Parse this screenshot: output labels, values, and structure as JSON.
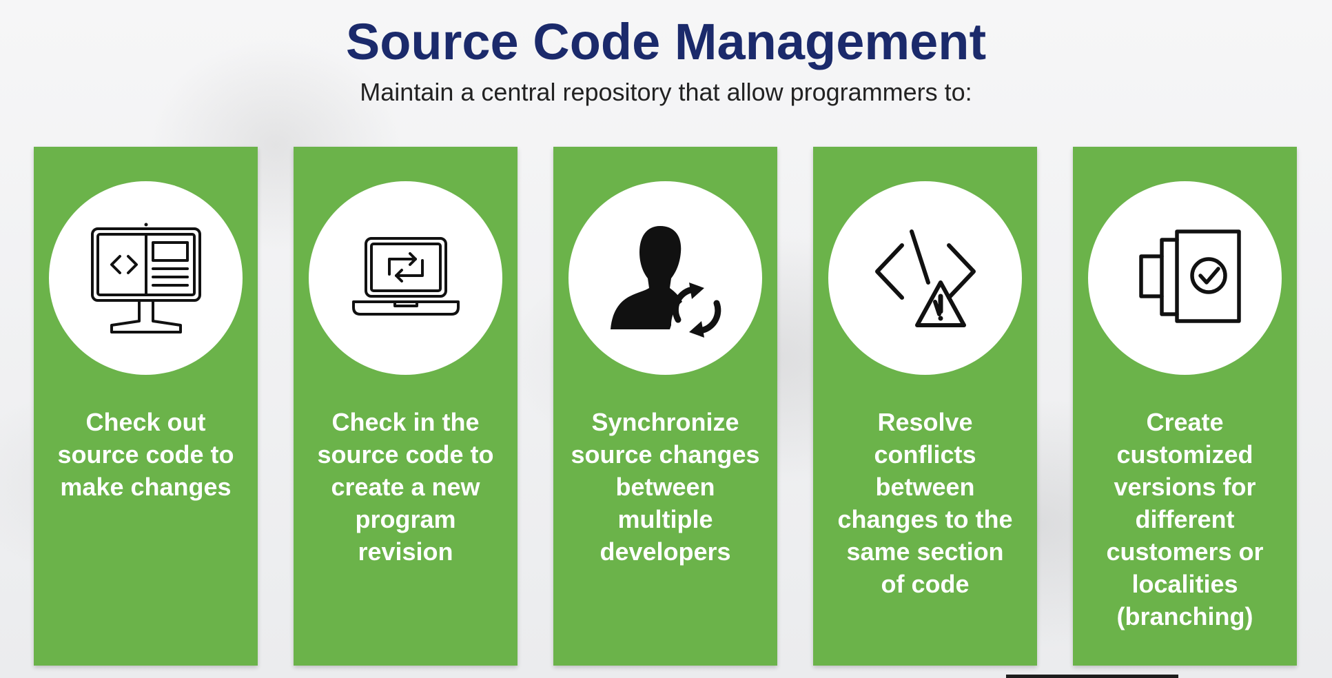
{
  "header": {
    "title": "Source Code Management",
    "subtitle": "Maintain a central repository that allow programmers to:"
  },
  "colors": {
    "card_green": "#6bb34a",
    "title_navy": "#1b2a6b"
  },
  "cards": [
    {
      "icon": "monitor-code-icon",
      "text": "Check out\nsource code to\nmake changes"
    },
    {
      "icon": "laptop-sync-icon",
      "text": "Check in the\nsource code to\ncreate a new\nprogram\nrevision"
    },
    {
      "icon": "user-sync-icon",
      "text": "Synchronize\nsource changes\nbetween\nmultiple\ndevelopers"
    },
    {
      "icon": "code-conflict-warning-icon",
      "text": "Resolve\nconflicts\nbetween\nchanges to the\nsame section\nof code"
    },
    {
      "icon": "document-version-check-icon",
      "text": "Create\ncustomized\nversions for\ndifferent\ncustomers or\nlocalities\n(branching)"
    }
  ]
}
